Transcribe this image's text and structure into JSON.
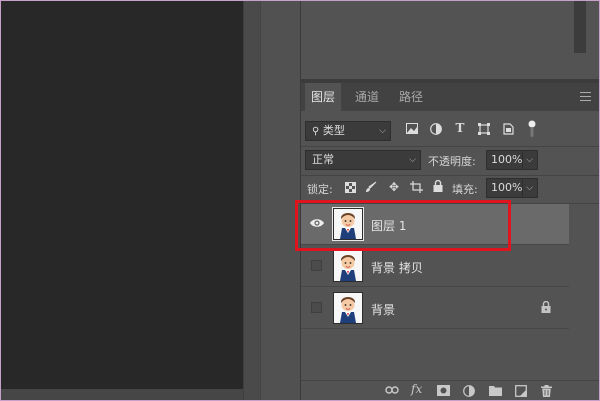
{
  "layers_panel": {
    "tabs": [
      {
        "label": "图层",
        "active": true
      },
      {
        "label": "通道",
        "active": false
      },
      {
        "label": "路径",
        "active": false
      }
    ],
    "filter": {
      "label": "类型"
    },
    "filter_icons": [
      "image-filter-icon",
      "adjustment-filter-icon",
      "type-filter-icon",
      "shape-filter-icon",
      "smart-object-filter-icon",
      "filter-toggle-icon"
    ],
    "blend_mode": "正常",
    "opacity": {
      "label": "不透明度:",
      "value": "100%"
    },
    "lock": {
      "label": "锁定:",
      "icons": [
        "lock-transparent-icon",
        "lock-paint-icon",
        "lock-move-icon",
        "lock-artboard-icon",
        "lock-all-icon"
      ]
    },
    "fill": {
      "label": "填充:",
      "value": "100%"
    },
    "layers": [
      {
        "name": "图层 1",
        "selected": true,
        "visible": true,
        "locked": false
      },
      {
        "name": "背景 拷贝",
        "selected": false,
        "visible": false,
        "locked": false
      },
      {
        "name": "背景",
        "selected": false,
        "visible": false,
        "locked": true
      }
    ],
    "footer_icons": [
      "link-icon",
      "fx-icon",
      "mask-icon",
      "adjustment-icon",
      "folder-icon",
      "new-layer-icon",
      "trash-icon"
    ]
  },
  "colors": {
    "highlight": "#e0141e",
    "selected_layer": "#6a6a6a",
    "canvas": "#282828"
  }
}
